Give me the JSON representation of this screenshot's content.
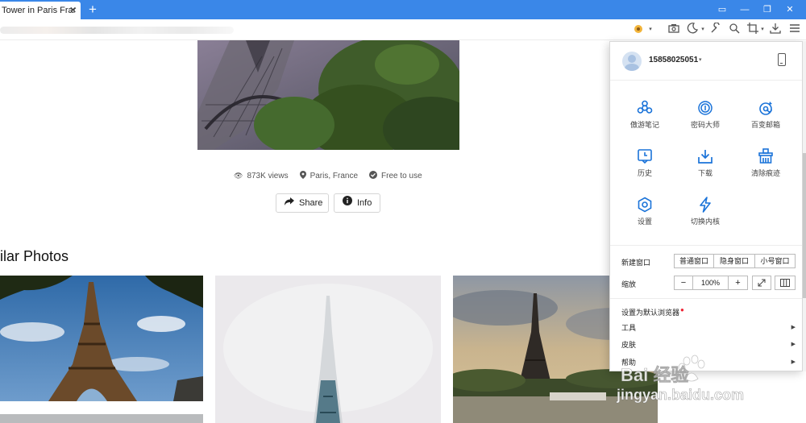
{
  "tab": {
    "title": "Tower in Paris Frar",
    "close": "✕",
    "new_tab": "+"
  },
  "window_controls": [
    "▭",
    "—",
    "❐",
    "✕"
  ],
  "toolbar": {
    "icons": [
      "extension-icon",
      "screenshot-icon",
      "night-mode-icon",
      "tools-icon",
      "translate-icon",
      "crop-icon",
      "download-icon",
      "menu-icon"
    ]
  },
  "photo_meta": {
    "views": "873K views",
    "location": "Paris, France",
    "license": "Free to use"
  },
  "actions": {
    "share": "Share",
    "info": "Info"
  },
  "similar": {
    "title": "ilar Photos"
  },
  "menu": {
    "user": {
      "name": "15858025051"
    },
    "grid": [
      {
        "label": "傲游笔记",
        "icon": "notes-icon"
      },
      {
        "label": "密码大师",
        "icon": "password-icon"
      },
      {
        "label": "百变邮箱",
        "icon": "mail-icon"
      },
      {
        "label": "历史",
        "icon": "history-icon"
      },
      {
        "label": "下载",
        "icon": "download-icon"
      },
      {
        "label": "清除痕迹",
        "icon": "clear-icon"
      },
      {
        "label": "设置",
        "icon": "settings-icon"
      },
      {
        "label": "切换内核",
        "icon": "lightning-icon"
      }
    ],
    "new_window": {
      "label": "新建窗口",
      "options": [
        "普通窗口",
        "隐身窗口",
        "小号窗口"
      ]
    },
    "zoom": {
      "label": "缩放",
      "minus": "−",
      "value": "100%",
      "plus": "+"
    },
    "default_browser": "设置为默认浏览器",
    "tools": "工具",
    "skin": "皮肤",
    "help": "帮助"
  },
  "watermark": {
    "logo": "Bai 经验",
    "url": "jingyan.baidu.com"
  },
  "colors": {
    "tabbar": "#3a87e8",
    "menu_icon": "#1a73d9"
  }
}
